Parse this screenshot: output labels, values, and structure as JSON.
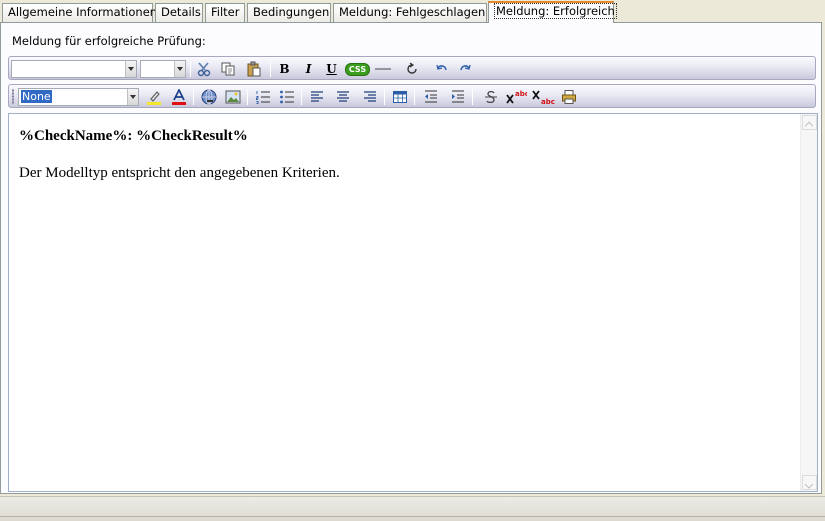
{
  "tabs": [
    {
      "label": "Allgemeine Informationen"
    },
    {
      "label": "Details"
    },
    {
      "label": "Filter"
    },
    {
      "label": "Bedingungen"
    },
    {
      "label": "Meldung: Fehlgeschlagen"
    },
    {
      "label": "Meldung: Erfolgreich",
      "active": true
    }
  ],
  "panel": {
    "label": "Meldung für erfolgreiche Prüfung:"
  },
  "toolbar1": {
    "font_combo": {
      "value": ""
    },
    "size_combo": {
      "value": ""
    },
    "bold_label": "B",
    "italic_label": "I",
    "underline_label": "U",
    "css_label": "CSS"
  },
  "toolbar2": {
    "style_combo": {
      "value": "None"
    }
  },
  "editor": {
    "heading": "%CheckName%: %CheckResult%",
    "body": "Der Modelltyp entspricht den angegebenen Kriterien."
  },
  "colors": {
    "active_tab_accent": "#e68b2c",
    "highlight_yellow": "#f4e62c",
    "font_color_red": "#e01010",
    "css_badge": "#3a9d1e"
  }
}
